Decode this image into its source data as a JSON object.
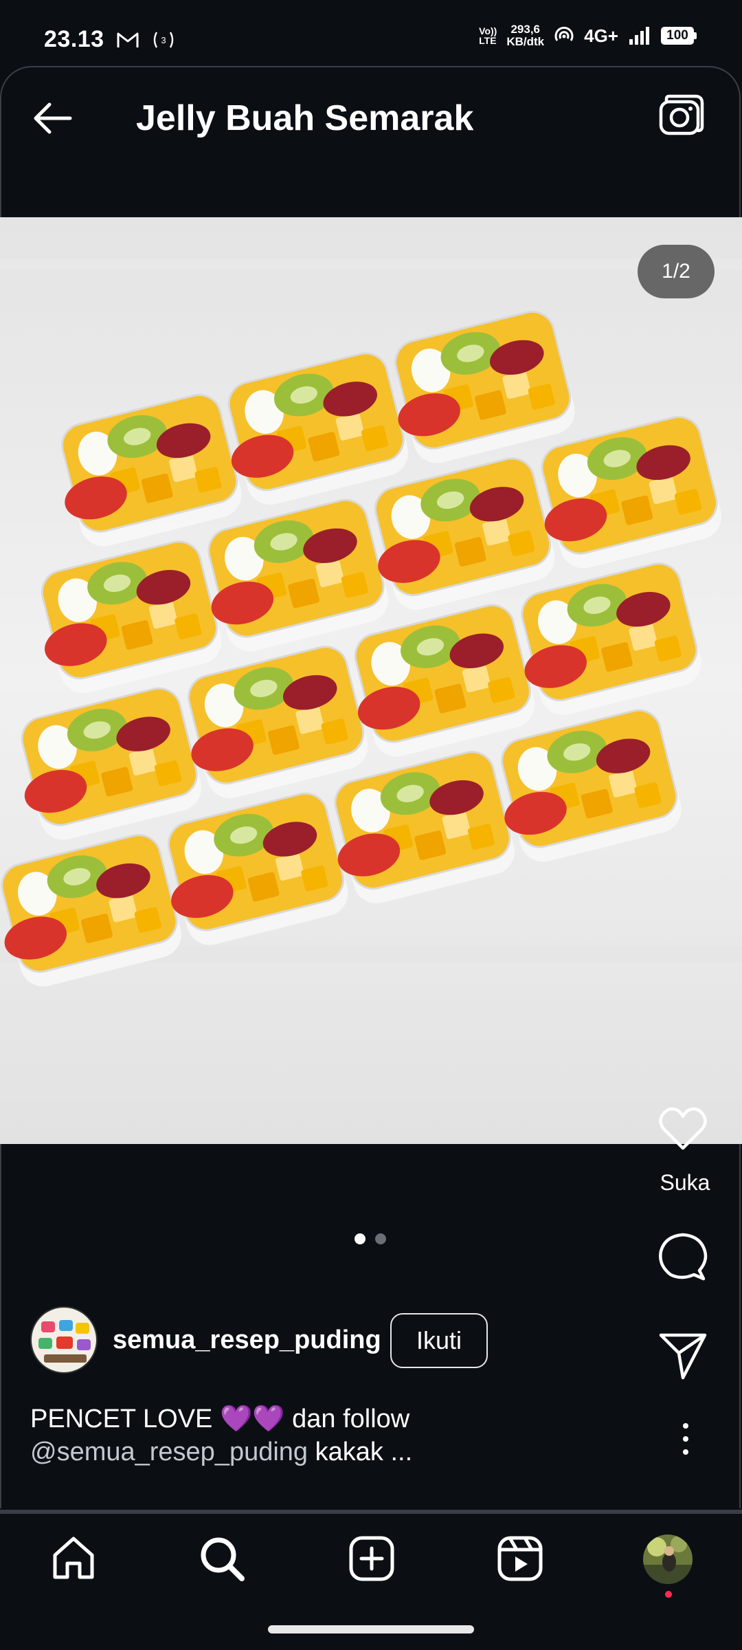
{
  "status_bar": {
    "time": "23.13",
    "volte_top": "Vo))",
    "volte_bottom": "LTE",
    "speed_value": "293,6",
    "speed_unit": "KB/dtk",
    "network": "4G+",
    "battery": "100"
  },
  "header": {
    "title": "Jelly Buah Semarak"
  },
  "media": {
    "counter": "1/2",
    "total_slides": 2,
    "active_slide": 1
  },
  "actions": {
    "like_label": "Suka"
  },
  "author": {
    "username": "semua_resep_puding",
    "follow_label": "Ikuti"
  },
  "caption": {
    "line1": "PENCET LOVE 💜💜 dan follow",
    "mention": "@semua_resep_puding",
    "line2_rest": " kakak ..."
  },
  "icons": {
    "back": "arrow-left-icon",
    "camera": "camera-icon",
    "like": "heart-icon",
    "comment": "comment-icon",
    "share": "send-icon",
    "more": "more-vertical-icon",
    "home": "home-icon",
    "search": "search-icon",
    "create": "plus-square-icon",
    "reels": "reels-icon"
  },
  "colors": {
    "background": "#0b0f14",
    "text": "#ffffff",
    "notification_dot": "#ff2d55"
  }
}
